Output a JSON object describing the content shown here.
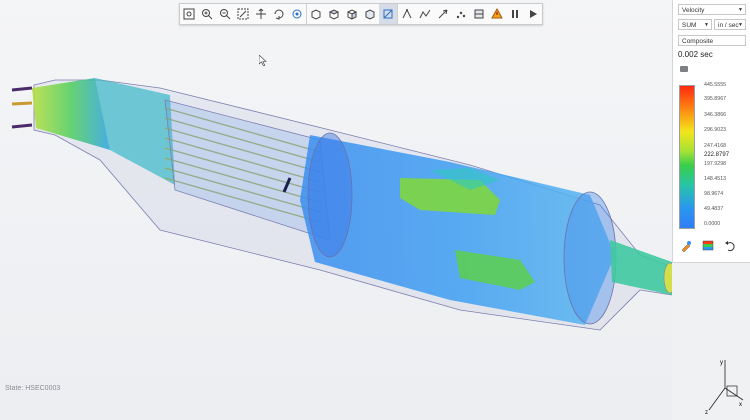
{
  "toolbar": {
    "buttons": [
      {
        "name": "zoom-fit-icon"
      },
      {
        "name": "zoom-in-icon"
      },
      {
        "name": "zoom-out-icon"
      },
      {
        "name": "zoom-window-icon"
      },
      {
        "name": "pan-icon"
      },
      {
        "name": "rotate-icon"
      },
      {
        "name": "zoom-area-icon"
      },
      {
        "name": "view-front-icon"
      },
      {
        "name": "view-top-icon"
      },
      {
        "name": "view-right-icon"
      },
      {
        "name": "view-iso-icon"
      },
      {
        "name": "probe-icon"
      },
      {
        "name": "plane-icon"
      },
      {
        "name": "section-icon"
      },
      {
        "name": "vector-icon"
      },
      {
        "name": "particle-icon"
      },
      {
        "name": "clip-icon"
      },
      {
        "name": "measure-icon"
      },
      {
        "name": "play-icon"
      },
      {
        "name": "pause-icon"
      }
    ]
  },
  "viewport": {
    "state_label": "State: HSEC0003"
  },
  "panel": {
    "quantity": "Velocity",
    "component": "SUM",
    "units": "in / sec",
    "mode": "Composite",
    "time": "0.002 sec",
    "legend": {
      "max": "445.5555",
      "ticks": [
        "395.8967",
        "346.3866",
        "296.9023",
        "247.4168",
        "222.8797",
        "197.9298",
        "148.4513",
        "98.9674",
        "49.4837",
        "0.0000"
      ],
      "colors": [
        "#ff2a12",
        "#f3e41c",
        "#38cf4a",
        "#2a97ef"
      ]
    }
  }
}
